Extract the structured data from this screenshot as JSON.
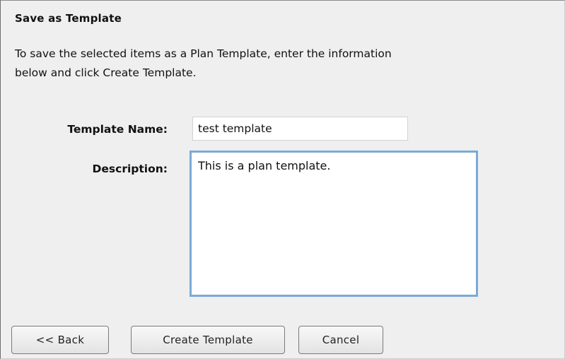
{
  "dialog": {
    "title": "Save as Template",
    "intro_line1": "To save the selected items as a Plan Template, enter the information",
    "intro_line2": "below and click Create Template."
  },
  "form": {
    "name_label": "Template Name:",
    "name_value": "test template",
    "description_label": "Description:",
    "description_value": "This is a plan template."
  },
  "buttons": {
    "back_label": "<< Back",
    "create_label": "Create Template",
    "cancel_label": "Cancel"
  },
  "colors": {
    "focus_border": "#7aaad6",
    "panel_background": "#efefef"
  }
}
